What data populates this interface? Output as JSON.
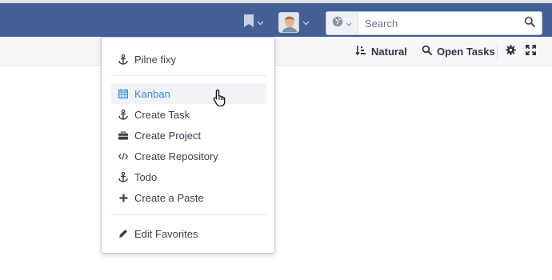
{
  "header": {
    "bookmark_icon": "bookmark-icon",
    "avatar_icon": "user-avatar",
    "search": {
      "scope_icon": "globe-icon",
      "placeholder": "Search",
      "submit_icon": "search-icon"
    }
  },
  "toolbar": {
    "order_label": "Natural",
    "open_tasks_label": "Open Tasks",
    "gear_icon": "gear-icon",
    "fullscreen_icon": "expand-icon"
  },
  "dropdown": {
    "items_top": [
      {
        "label": "Pilne fixy",
        "icon": "anchor-icon"
      }
    ],
    "items_middle": [
      {
        "label": "Kanban",
        "icon": "calendar-icon",
        "highlighted": true
      },
      {
        "label": "Create Task",
        "icon": "anchor-icon"
      },
      {
        "label": "Create Project",
        "icon": "briefcase-icon"
      },
      {
        "label": "Create Repository",
        "icon": "code-icon"
      },
      {
        "label": "Todo",
        "icon": "anchor-icon"
      },
      {
        "label": "Create a Paste",
        "icon": "plus-icon"
      }
    ],
    "items_bottom": [
      {
        "label": "Edit Favorites",
        "icon": "pencil-icon"
      }
    ]
  },
  "colors": {
    "header_bg": "#445f94",
    "accent_link": "#3c8ad0",
    "toolbar_bg": "#f7f7f9"
  }
}
